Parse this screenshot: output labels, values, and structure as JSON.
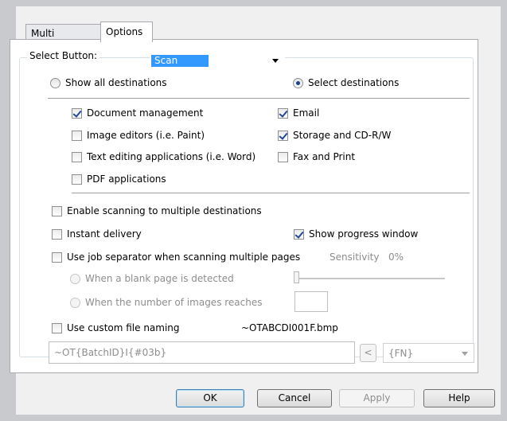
{
  "tabs": [
    {
      "label": "Multi Function"
    },
    {
      "label": "Options"
    }
  ],
  "select_button": {
    "label": "Select Button:",
    "value": "Scan"
  },
  "destinations": {
    "show_all_label": "Show all destinations",
    "select_label": "Select destinations",
    "selected_mode": "select",
    "items": [
      {
        "label": "Document management",
        "checked": true
      },
      {
        "label": "Image editors (i.e. Paint)",
        "checked": false
      },
      {
        "label": "Text editing applications (i.e. Word)",
        "checked": false
      },
      {
        "label": "PDF applications",
        "checked": false
      },
      {
        "label": "Email",
        "checked": true
      },
      {
        "label": "Storage and CD-R/W",
        "checked": true
      },
      {
        "label": "Fax and Print",
        "checked": false
      }
    ]
  },
  "options": {
    "multi_dest_label": "Enable scanning to multiple destinations",
    "instant_delivery_label": "Instant delivery",
    "show_progress_label": "Show progress window",
    "job_separator_label": "Use job separator when scanning multiple pages",
    "sensitivity_label": "Sensitivity",
    "sensitivity_value": "0%",
    "blank_page_label": "When a blank page is detected",
    "num_images_label": "When the number of images reaches",
    "custom_naming_label": "Use custom file naming",
    "filename_preview": "~OTABCDI001F.bmp",
    "naming_pattern": "~OT{BatchID}I{#03b}",
    "insert_button": "<",
    "token_value": "{FN}"
  },
  "buttons": {
    "ok": "OK",
    "cancel": "Cancel",
    "apply": "Apply",
    "help": "Help"
  },
  "colors": {
    "dialog_bg": "#f0f0f0",
    "selection": "#3399ff",
    "check": "#21469e"
  }
}
